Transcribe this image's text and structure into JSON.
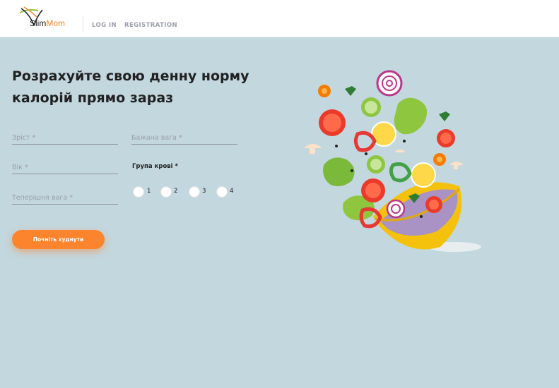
{
  "header": {
    "logo": {
      "prefix": "Slim",
      "suffix": "Mom"
    },
    "nav": {
      "login": "LOG IN",
      "registration": "REGISTRATION"
    }
  },
  "main": {
    "title": "Розрахуйте свою денну норму калорій прямо зараз",
    "form": {
      "height_placeholder": "Зріст *",
      "desired_weight_placeholder": "Бажана вага *",
      "age_placeholder": "Вік *",
      "current_weight_placeholder": "Теперішня вага *",
      "blood_group_label": "Група крові *",
      "blood_options": [
        "1",
        "2",
        "3",
        "4"
      ],
      "submit_label": "Почніть худнути"
    }
  },
  "colors": {
    "accent": "#fc842d",
    "background": "#c3d7de",
    "text": "#212121",
    "muted": "#9b9faa"
  },
  "icons": [
    "logo-icon",
    "salad-illustration"
  ]
}
